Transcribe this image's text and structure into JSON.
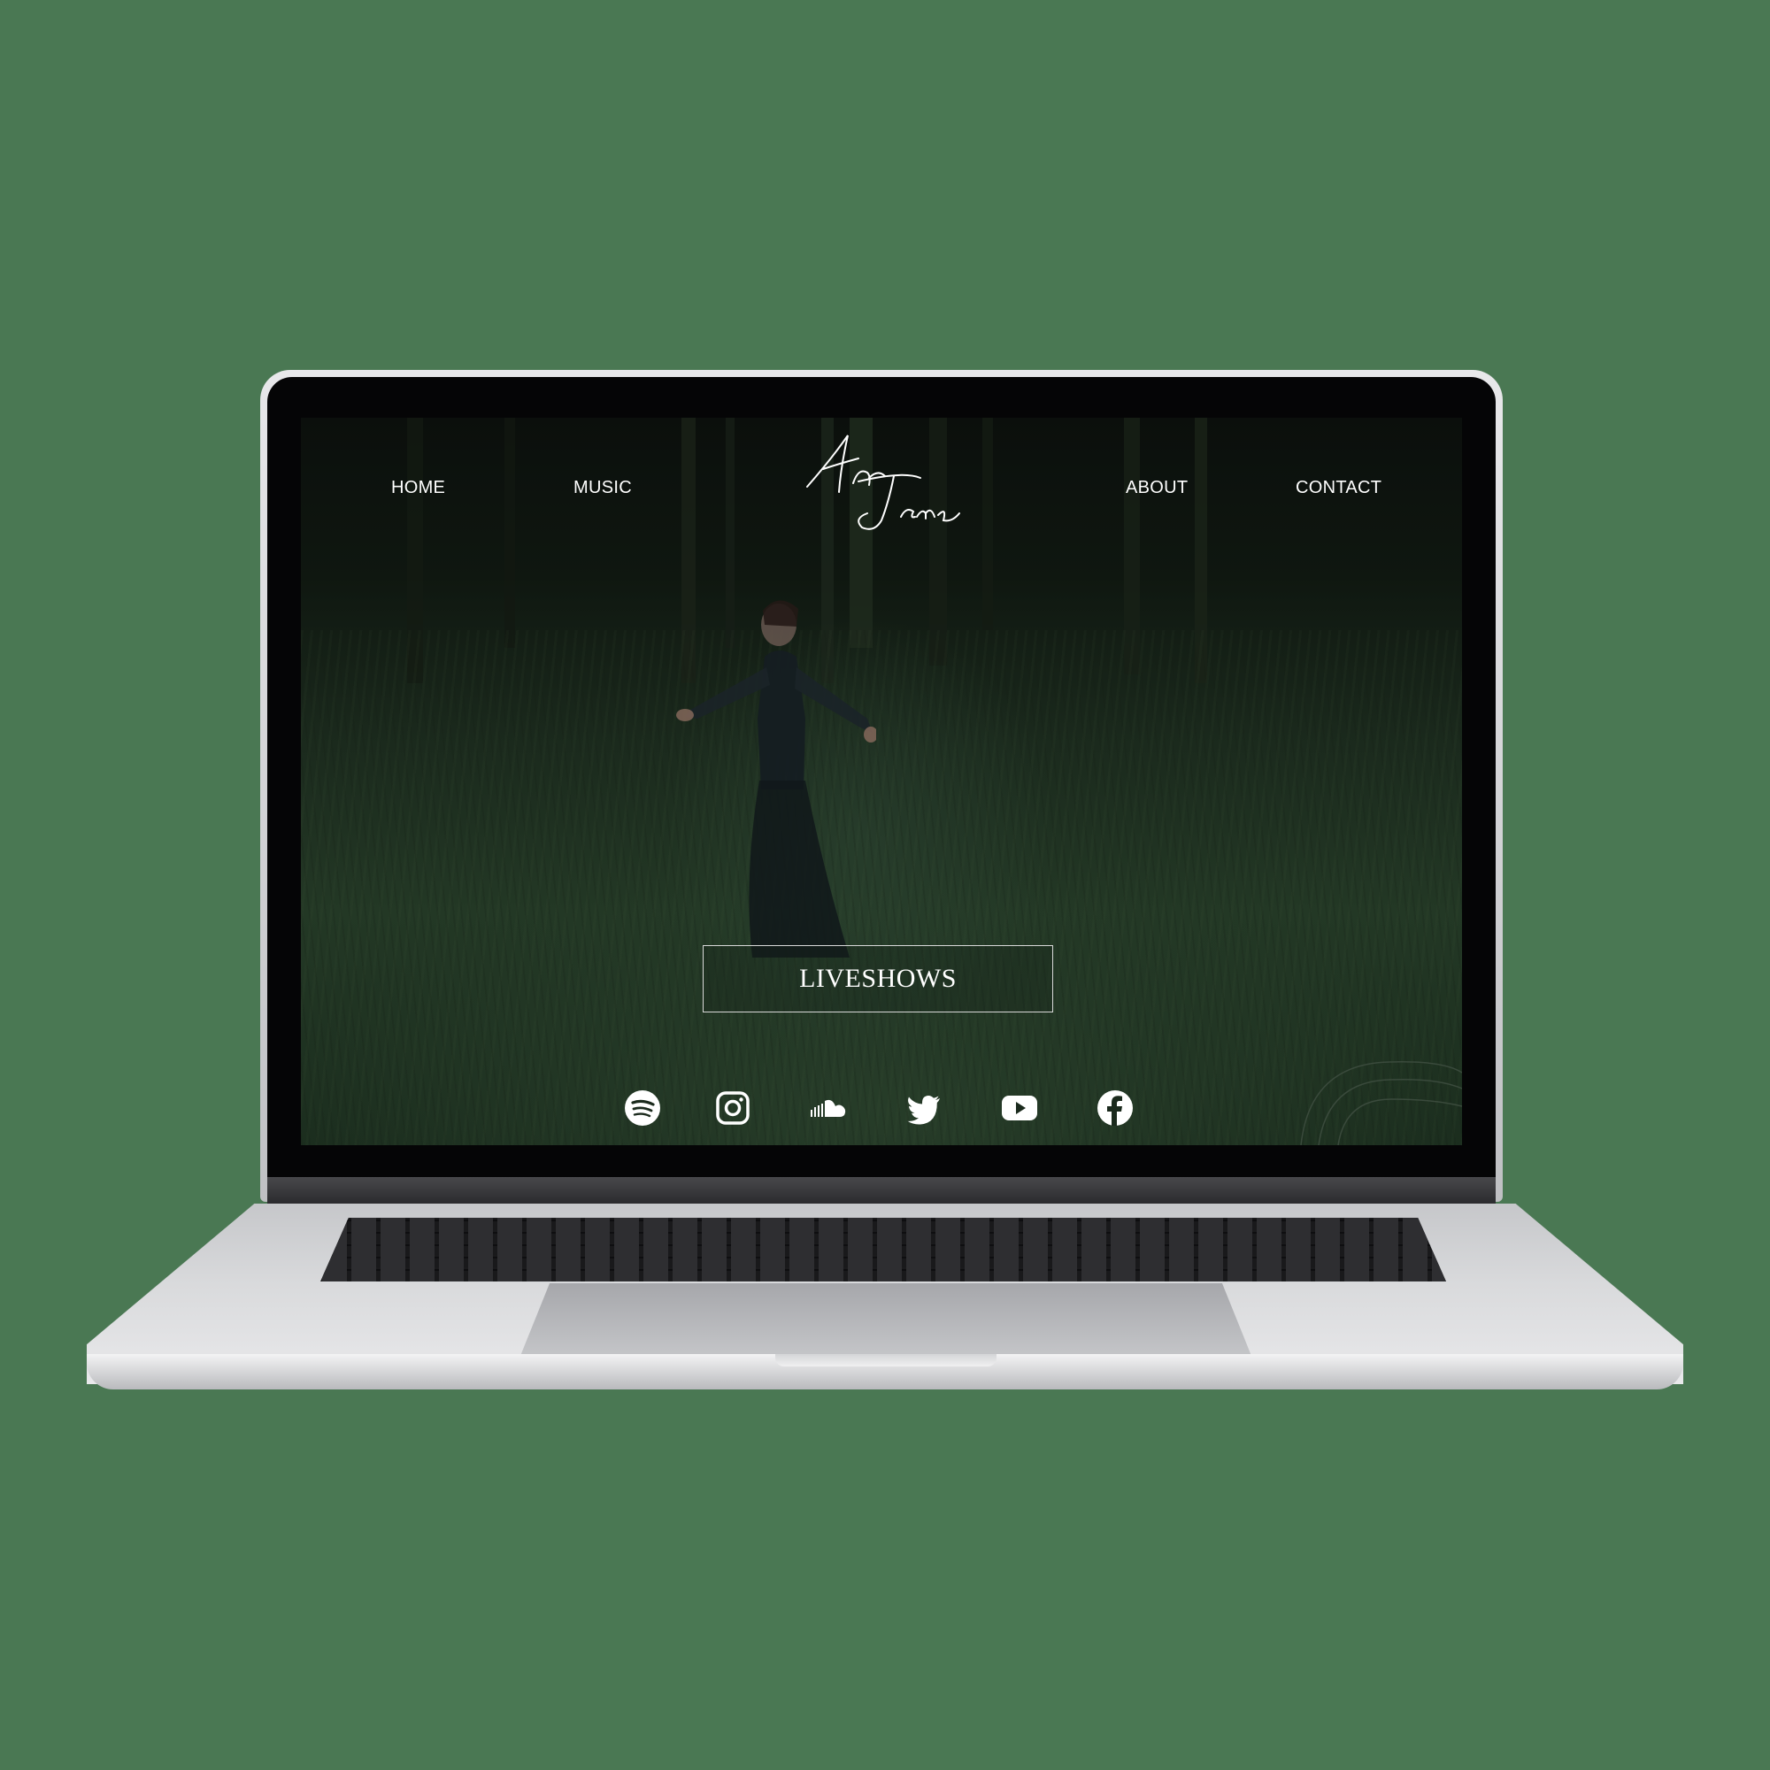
{
  "nav": {
    "home": "HOME",
    "music": "MUSIC",
    "about": "ABOUT",
    "contact": "CONTACT"
  },
  "logo": {
    "line1": "An",
    "line2": "Jane"
  },
  "hero": {
    "cta_label": "LIVESHOWS"
  },
  "social": {
    "icons": [
      "spotify-icon",
      "instagram-icon",
      "soundcloud-icon",
      "twitter-icon",
      "youtube-icon",
      "facebook-icon"
    ]
  },
  "colors": {
    "page_background": "#4a7853",
    "screen_text": "#ffffff"
  }
}
